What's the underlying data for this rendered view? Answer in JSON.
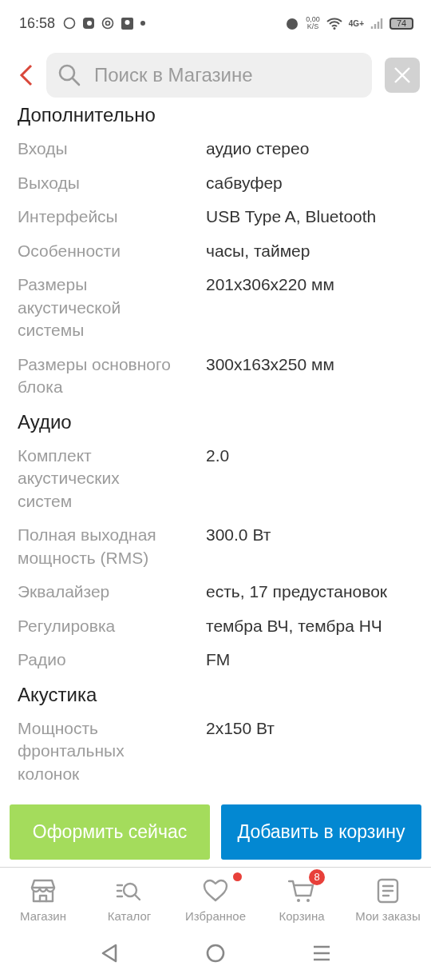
{
  "status_bar": {
    "time": "16:58",
    "net_speed": "0,00",
    "net_unit": "K/S",
    "network": "4G+",
    "battery": "74"
  },
  "search": {
    "placeholder": "Поиск в Магазине"
  },
  "sections": [
    {
      "title": "Дополнительно",
      "rows": [
        {
          "label": "Входы",
          "value": "аудио стерео"
        },
        {
          "label": "Выходы",
          "value": "сабвуфер"
        },
        {
          "label": "Интерфейсы",
          "value": "USB Type A, Bluetooth"
        },
        {
          "label": "Особенности",
          "value": "часы, таймер"
        },
        {
          "label": "Размеры акустической системы",
          "value": "201x306x220 мм"
        },
        {
          "label": "Размеры основного блока",
          "value": "300x163x250 мм"
        }
      ]
    },
    {
      "title": "Аудио",
      "rows": [
        {
          "label": "Комплект акустических систем",
          "value": "2.0"
        },
        {
          "label": "Полная выходная мощность (RMS)",
          "value": "300.0 Вт"
        },
        {
          "label": "Эквалайзер",
          "value": "есть, 17 предустановок"
        },
        {
          "label": "Регулировка",
          "value": "тембра ВЧ, тембра НЧ"
        },
        {
          "label": "Радио",
          "value": "FM"
        }
      ]
    },
    {
      "title": "Акустика",
      "rows": [
        {
          "label": "Мощность фронтальных колонок",
          "value": "2x150 Вт"
        }
      ]
    }
  ],
  "actions": [
    {
      "label": "Оформить сейчас",
      "kind": "buy"
    },
    {
      "label": "Добавить в корзину",
      "kind": "cart"
    }
  ],
  "nav": [
    {
      "label": "Магазин",
      "kind": "store",
      "dot": false
    },
    {
      "label": "Каталог",
      "kind": "catalog",
      "dot": false
    },
    {
      "label": "Избранное",
      "kind": "favorites",
      "dot": true
    },
    {
      "label": "Корзина",
      "kind": "cart",
      "dot": false,
      "badge": "8"
    },
    {
      "label": "Мои заказы",
      "kind": "orders",
      "dot": false
    }
  ]
}
